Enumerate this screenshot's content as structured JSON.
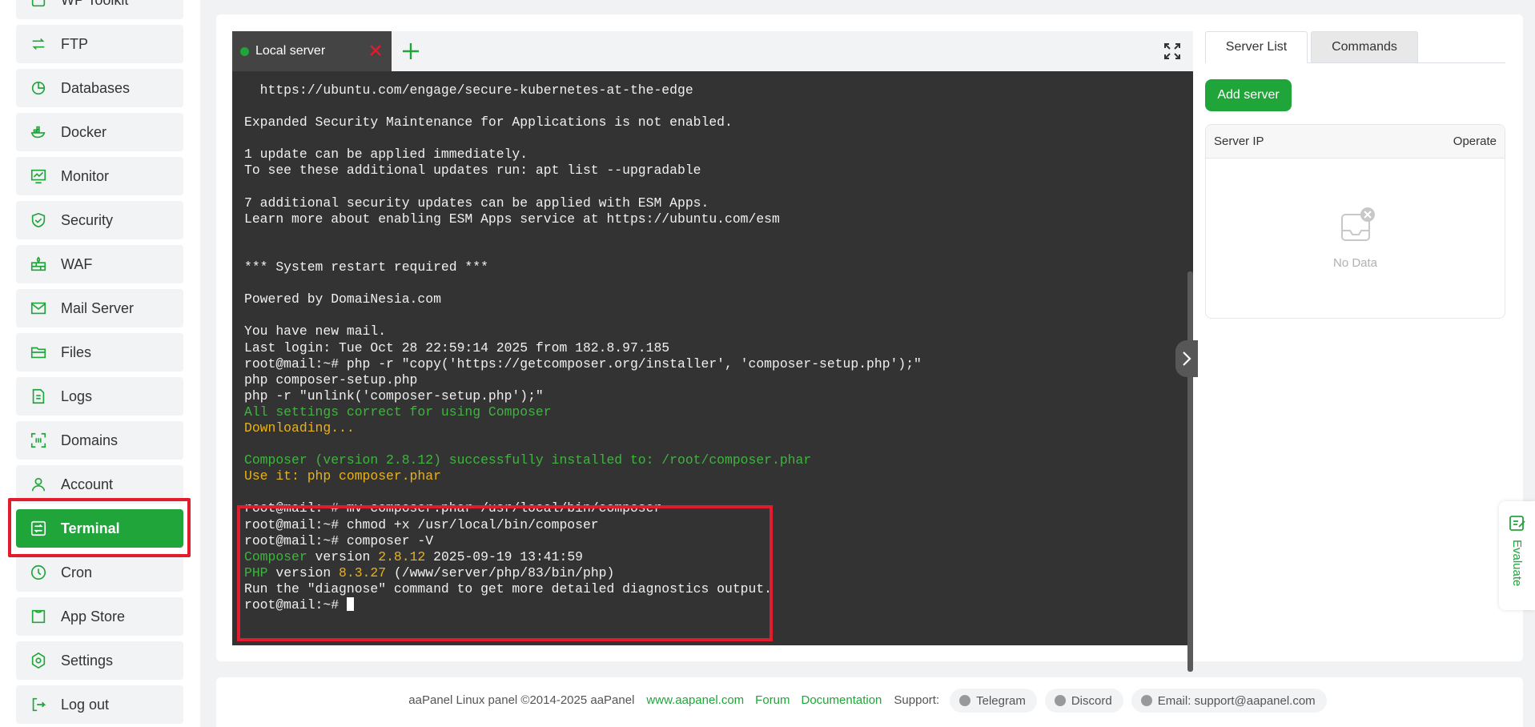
{
  "sidebar": {
    "items": [
      {
        "label": "WP Toolkit",
        "icon": "wp-icon"
      },
      {
        "label": "FTP",
        "icon": "ftp-icon"
      },
      {
        "label": "Databases",
        "icon": "database-icon"
      },
      {
        "label": "Docker",
        "icon": "docker-icon"
      },
      {
        "label": "Monitor",
        "icon": "monitor-icon"
      },
      {
        "label": "Security",
        "icon": "shield-icon"
      },
      {
        "label": "WAF",
        "icon": "firewall-icon"
      },
      {
        "label": "Mail Server",
        "icon": "mail-icon"
      },
      {
        "label": "Files",
        "icon": "folder-icon"
      },
      {
        "label": "Logs",
        "icon": "logs-icon"
      },
      {
        "label": "Domains",
        "icon": "domains-icon"
      },
      {
        "label": "Account",
        "icon": "user-icon"
      },
      {
        "label": "Terminal",
        "icon": "terminal-icon",
        "active": true
      },
      {
        "label": "Cron",
        "icon": "clock-icon"
      },
      {
        "label": "App Store",
        "icon": "store-icon"
      },
      {
        "label": "Settings",
        "icon": "gear-icon"
      },
      {
        "label": "Log out",
        "icon": "logout-icon"
      }
    ]
  },
  "terminal": {
    "tab_label": "Local server",
    "lines": [
      {
        "text": "  https://ubuntu.com/engage/secure-kubernetes-at-the-edge",
        "color": "default"
      },
      {
        "text": "",
        "color": "default"
      },
      {
        "text": "Expanded Security Maintenance for Applications is not enabled.",
        "color": "default"
      },
      {
        "text": "",
        "color": "default"
      },
      {
        "text": "1 update can be applied immediately.",
        "color": "default"
      },
      {
        "text": "To see these additional updates run: apt list --upgradable",
        "color": "default"
      },
      {
        "text": "",
        "color": "default"
      },
      {
        "text": "7 additional security updates can be applied with ESM Apps.",
        "color": "default"
      },
      {
        "text": "Learn more about enabling ESM Apps service at https://ubuntu.com/esm",
        "color": "default"
      },
      {
        "text": "",
        "color": "default"
      },
      {
        "text": "",
        "color": "default"
      },
      {
        "text": "*** System restart required ***",
        "color": "default"
      },
      {
        "text": "",
        "color": "default"
      },
      {
        "text": "Powered by DomaiNesia.com",
        "color": "default"
      },
      {
        "text": "",
        "color": "default"
      },
      {
        "text": "You have new mail.",
        "color": "default"
      },
      {
        "text": "Last login: Tue Oct 28 22:59:14 2025 from 182.8.97.185",
        "color": "default"
      },
      {
        "text": "root@mail:~# php -r \"copy('https://getcomposer.org/installer', 'composer-setup.php');\"",
        "color": "default"
      },
      {
        "text": "php composer-setup.php",
        "color": "default"
      },
      {
        "text": "php -r \"unlink('composer-setup.php');\"",
        "color": "default"
      },
      {
        "text": "All settings correct for using Composer",
        "color": "green"
      },
      {
        "text": "Downloading...",
        "color": "yellow"
      },
      {
        "text": "",
        "color": "default"
      },
      {
        "text": "Composer (version 2.8.12) successfully installed to: /root/composer.phar",
        "color": "green"
      },
      {
        "text": "Use it: php composer.phar",
        "color": "yellow"
      },
      {
        "text": "",
        "color": "default"
      },
      {
        "text": "root@mail:~# mv composer.phar /usr/local/bin/composer",
        "color": "default"
      },
      {
        "text": "root@mail:~# chmod +x /usr/local/bin/composer",
        "color": "default"
      },
      {
        "text": "root@mail:~# composer -V",
        "color": "default"
      }
    ],
    "version_line": {
      "part1": "Composer",
      "part2": " version ",
      "part3": "2.8.12",
      "part4": " 2025-09-19 13:41:59"
    },
    "php_line": {
      "part1": "PHP",
      "part2": " version ",
      "part3": "8.3.27",
      "part4": " (/www/server/php/83/bin/php)"
    },
    "diagnose_line": "Run the \"diagnose\" command to get more detailed diagnostics output.",
    "prompt": "root@mail:~# "
  },
  "panel": {
    "tabs": [
      "Server List",
      "Commands"
    ],
    "add_button": "Add server",
    "table_headers": [
      "Server IP",
      "Operate"
    ],
    "empty_text": "No Data"
  },
  "evaluate_label": "Evaluate",
  "footer": {
    "copyright": "aaPanel Linux panel ©2014-2025 aaPanel",
    "links": [
      "www.aapanel.com",
      "Forum",
      "Documentation"
    ],
    "support_label": "Support:",
    "support_pills": [
      "Telegram",
      "Discord",
      "Email: support@aapanel.com"
    ]
  },
  "colors": {
    "accent": "#20a53a",
    "highlight": "#e21b2d",
    "terminal_bg": "#333333",
    "term_green": "#3fb43f",
    "term_yellow": "#e8b21c"
  }
}
